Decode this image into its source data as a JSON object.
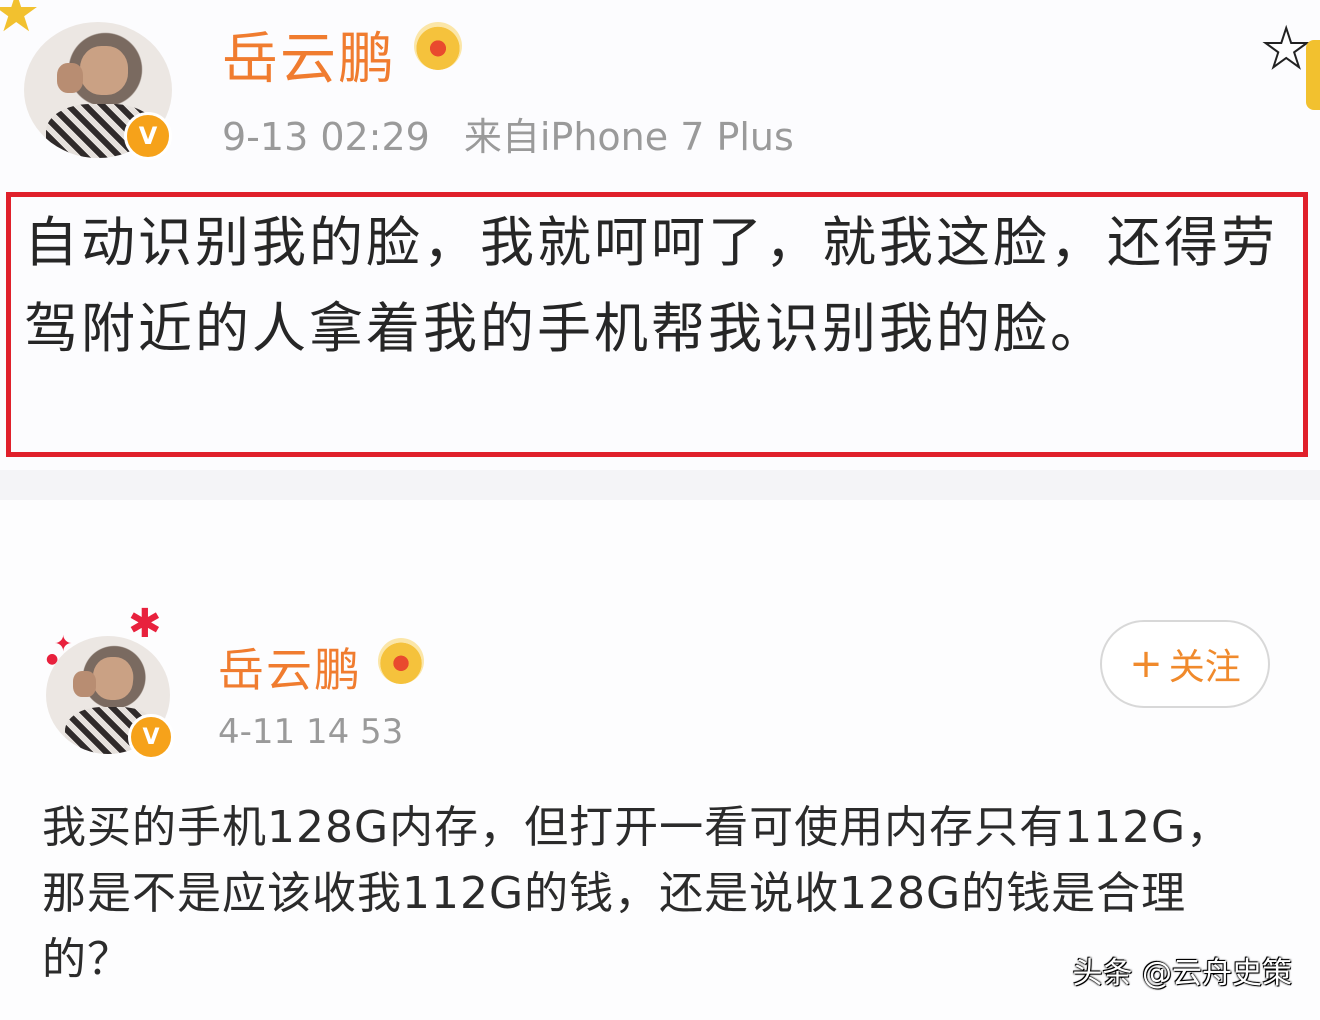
{
  "post1": {
    "username": "岳云鹏",
    "timestamp": "9-13 02:29",
    "source": "来自iPhone 7 Plus",
    "content": "自动识别我的脸，我就呵呵了，就我这脸，还得劳驾附近的人拿着我的手机帮我识别我的脸。",
    "verified_badge": "V",
    "icons": [
      "avatar",
      "verified-badge-icon",
      "crown-icon",
      "star-icon"
    ]
  },
  "post2": {
    "username": "岳云鹏",
    "timestamp": "4-11 14 53",
    "follow_label": "关注",
    "follow_plus": "+",
    "verified_badge": "V",
    "content": "我买的手机128G内存，但打开一看可使用内存只有112G，那是不是应该收我112G的钱，还是说收128G的钱是合理的？",
    "icons": [
      "avatar",
      "verified-badge-icon",
      "crown-icon",
      "sparkle-star-icon"
    ]
  },
  "watermark": "头条 @云舟史策",
  "colors": {
    "username": "#f07c2f",
    "highlight_border": "#e0202b",
    "verified_badge": "#f6a21a",
    "meta_text": "#9a9a9a",
    "follow_text": "#f08a2c"
  }
}
